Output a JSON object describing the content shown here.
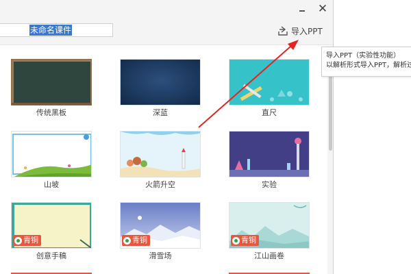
{
  "window": {
    "close_glyph": "✕"
  },
  "header": {
    "title_value": "未命名课件",
    "import_label": "导入PPT"
  },
  "tooltip": {
    "line1": "导入PPT（实验性功能）",
    "line2": "以解析形式导入PPT，解析过"
  },
  "templates": [
    {
      "label": "传统黑板",
      "badge": ""
    },
    {
      "label": "深蓝",
      "badge": ""
    },
    {
      "label": "直尺",
      "badge": ""
    },
    {
      "label": "山坡",
      "badge": ""
    },
    {
      "label": "火箭升空",
      "badge": ""
    },
    {
      "label": "实验",
      "badge": ""
    },
    {
      "label": "创意手稿",
      "badge": "青铜"
    },
    {
      "label": "滑雪场",
      "badge": "青铜"
    },
    {
      "label": "江山画卷",
      "badge": "青铜"
    }
  ],
  "colors": {
    "annotation_arrow": "#e8231f",
    "badge": "#e8573d",
    "selection": "#3b78cf"
  },
  "icons": {
    "import": "import-icon",
    "minimize": "minimize-icon",
    "close": "close-icon"
  }
}
